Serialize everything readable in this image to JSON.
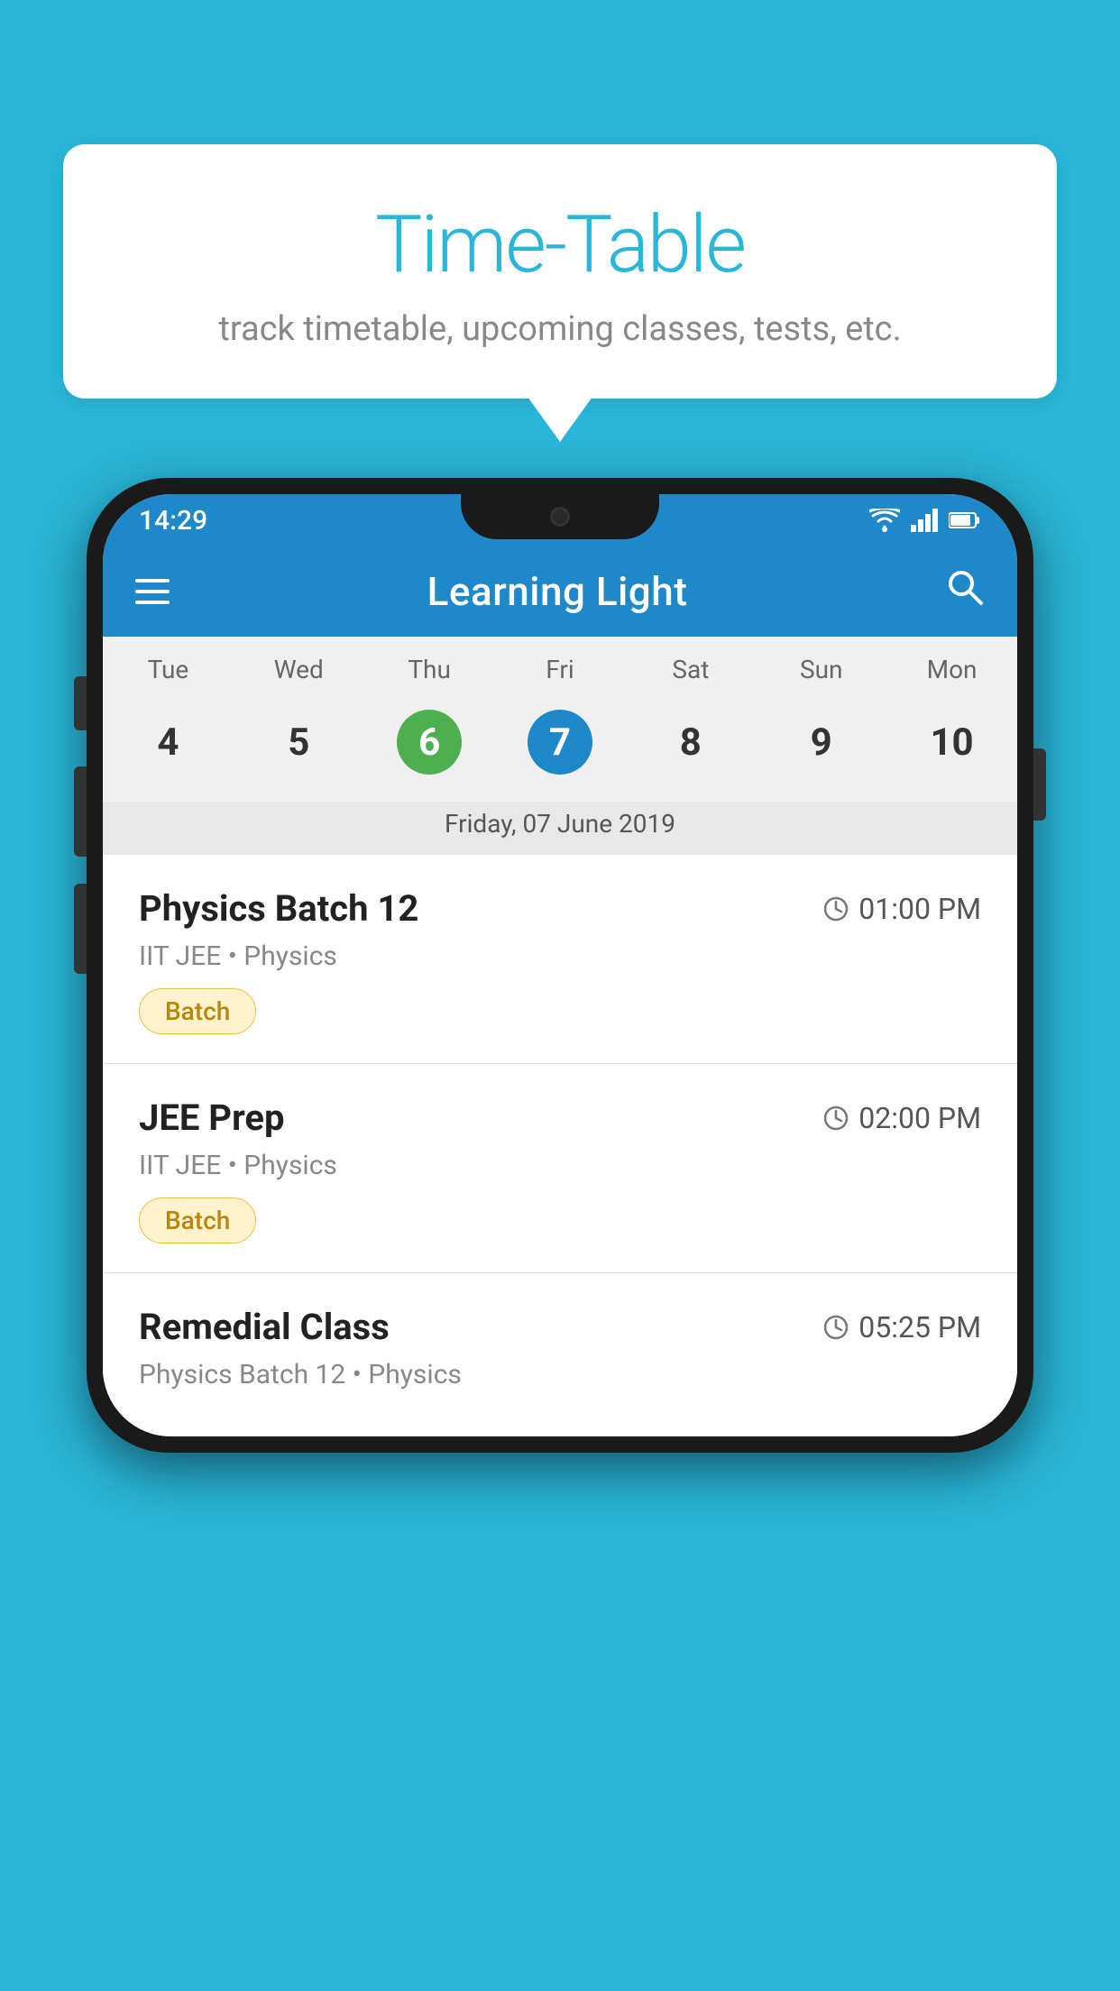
{
  "background_color": "#29B6D8",
  "speech_bubble": {
    "title": "Time-Table",
    "subtitle": "track timetable, upcoming classes, tests, etc."
  },
  "phone": {
    "status_bar": {
      "time": "14:29",
      "icons": [
        "wifi",
        "signal",
        "battery"
      ]
    },
    "toolbar": {
      "title": "Learning Light",
      "menu_label": "menu",
      "search_label": "search"
    },
    "calendar": {
      "days_of_week": [
        "Tue",
        "Wed",
        "Thu",
        "Fri",
        "Sat",
        "Sun",
        "Mon"
      ],
      "dates": [
        "4",
        "5",
        "6",
        "7",
        "8",
        "9",
        "10"
      ],
      "today_index": 2,
      "selected_index": 3,
      "selected_date_label": "Friday, 07 June 2019"
    },
    "schedule": [
      {
        "title": "Physics Batch 12",
        "time": "01:00 PM",
        "meta": "IIT JEE • Physics",
        "badge": "Batch"
      },
      {
        "title": "JEE Prep",
        "time": "02:00 PM",
        "meta": "IIT JEE • Physics",
        "badge": "Batch"
      },
      {
        "title": "Remedial Class",
        "time": "05:25 PM",
        "meta": "Physics Batch 12 • Physics",
        "badge": ""
      }
    ]
  }
}
